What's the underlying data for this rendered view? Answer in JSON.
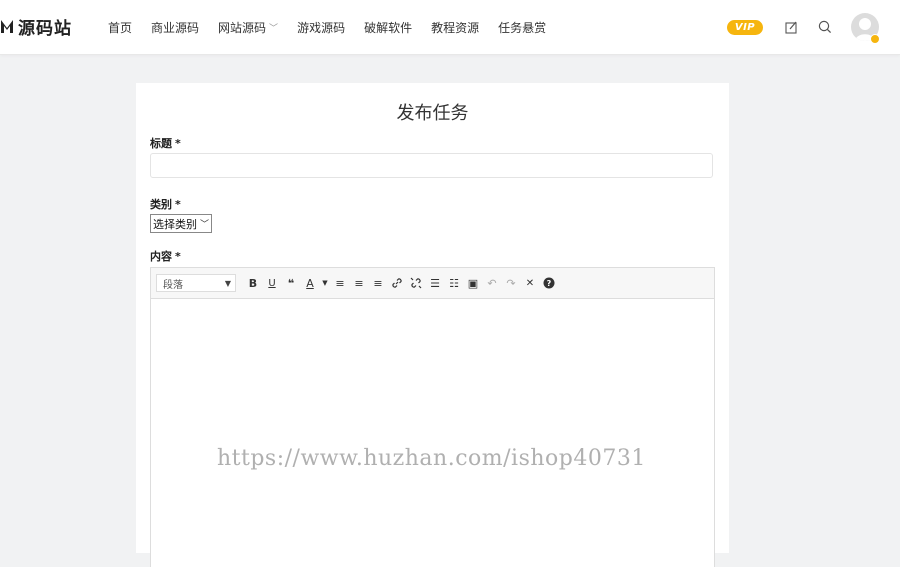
{
  "brand": {
    "name": "源码站"
  },
  "nav": {
    "items": [
      {
        "label": "首页"
      },
      {
        "label": "商业源码"
      },
      {
        "label": "网站源码",
        "has_dropdown": true
      },
      {
        "label": "游戏源码"
      },
      {
        "label": "破解软件"
      },
      {
        "label": "教程资源"
      },
      {
        "label": "任务悬赏"
      }
    ]
  },
  "header_right": {
    "vip_label": "VIP",
    "icons": [
      "edit-icon",
      "search-icon",
      "user-avatar-icon"
    ]
  },
  "form": {
    "title": "发布任务",
    "title_field": {
      "label": "标题",
      "required_mark": "*",
      "value": "",
      "placeholder": ""
    },
    "category_field": {
      "label": "类别",
      "required_mark": "*",
      "selected": "选择类别"
    },
    "content_field": {
      "label": "内容",
      "required_mark": "*"
    },
    "toolbar": {
      "format_select": "段落",
      "buttons": [
        {
          "name": "bold",
          "glyph": "B"
        },
        {
          "name": "underline",
          "glyph": "U"
        },
        {
          "name": "blockquote",
          "glyph": "❝"
        },
        {
          "name": "text-color",
          "glyph": "A"
        },
        {
          "name": "align-left",
          "glyph": "≡"
        },
        {
          "name": "align-center",
          "glyph": "≡"
        },
        {
          "name": "align-right",
          "glyph": "≡"
        },
        {
          "name": "link",
          "glyph": "🔗"
        },
        {
          "name": "unlink",
          "glyph": "⛓"
        },
        {
          "name": "bullet-list",
          "glyph": "☰"
        },
        {
          "name": "numbered-list",
          "glyph": "☷"
        },
        {
          "name": "image",
          "glyph": "▣"
        },
        {
          "name": "undo",
          "glyph": "↶"
        },
        {
          "name": "redo",
          "glyph": "↷"
        },
        {
          "name": "fullscreen",
          "glyph": "✕"
        },
        {
          "name": "help",
          "glyph": "?"
        }
      ]
    },
    "watermark": "https://www.huzhan.com/ishop40731"
  },
  "colors": {
    "accent": "#f6b50e",
    "page_bg": "#f1f2f3",
    "card_bg": "#ffffff"
  }
}
